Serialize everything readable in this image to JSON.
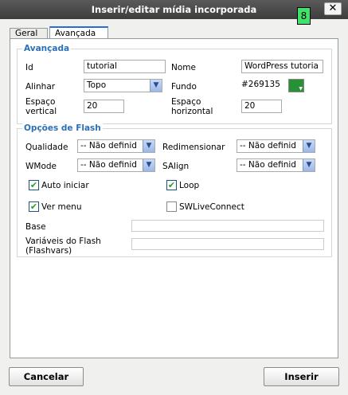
{
  "window": {
    "title": "Inserir/editar mídia incorporada",
    "close_label": "✕",
    "badge": "8"
  },
  "tabs": [
    {
      "label": "Geral"
    },
    {
      "label": "Avançada"
    }
  ],
  "advanced": {
    "legend": "Avançada",
    "id_label": "Id",
    "id_value": "tutorial",
    "name_label": "Nome",
    "name_value": "WordPress tutoria",
    "align_label": "Alinhar",
    "align_value": "Topo",
    "background_label": "Fundo",
    "background_value": "#269135",
    "background_color": "#269135",
    "vspace_label_1": "Espaço",
    "vspace_label_2": "vertical",
    "vspace_value": "20",
    "hspace_label_1": "Espaço",
    "hspace_label_2": "horizontal",
    "hspace_value": "20"
  },
  "flash": {
    "legend": "Opções de Flash",
    "quality_label": "Qualidade",
    "quality_value": "-- Não definid",
    "scale_label": "Redimensionar",
    "scale_value": "-- Não definid",
    "wmode_label": "WMode",
    "wmode_value": "-- Não definid",
    "salign_label": "SAlign",
    "salign_value": "-- Não definid",
    "autoplay_label": "Auto iniciar",
    "autoplay_checked": true,
    "loop_label": "Loop",
    "loop_checked": true,
    "menu_label": "Ver menu",
    "menu_checked": true,
    "swlive_label": "SWLiveConnect",
    "swlive_checked": false,
    "base_label": "Base",
    "base_value": "",
    "flashvars_label_1": "Variáveis do Flash",
    "flashvars_label_2": "(Flashvars)",
    "flashvars_value": ""
  },
  "footer": {
    "cancel_label": "Cancelar",
    "insert_label": "Inserir"
  }
}
